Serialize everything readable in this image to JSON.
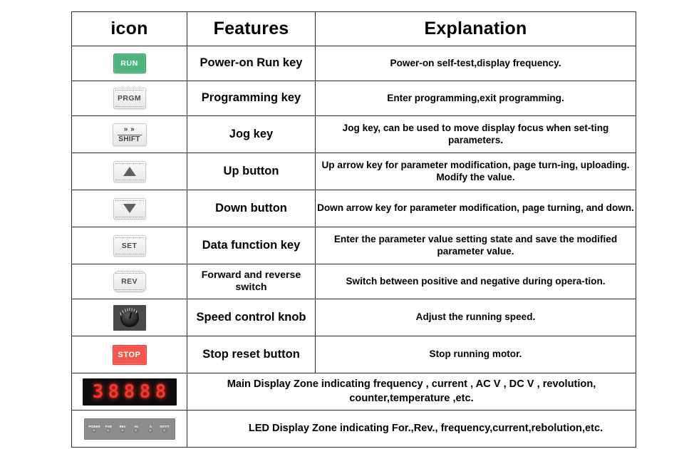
{
  "table": {
    "headers": {
      "icon": "icon",
      "features": "Features",
      "explanation": "Explanation"
    },
    "rows": [
      {
        "icon_kind": "run-key",
        "icon_label": "RUN",
        "feature": "Power-on  Run key",
        "explanation": "Power-on self-test,display frequency."
      },
      {
        "icon_kind": "prgm-key",
        "icon_label": "PRGM",
        "feature": "Programming  key",
        "explanation": "Enter programming,exit programming."
      },
      {
        "icon_kind": "shift-key",
        "icon_label_top": "» »",
        "icon_label": "SHIFT",
        "feature": "Jog  key",
        "explanation": "Jog key, can be used to move display focus when set-ting parameters."
      },
      {
        "icon_kind": "up-arrow-key",
        "icon_label": "",
        "feature": "Up  button",
        "explanation": "Up arrow key for parameter modification, page turn-ing, uploading. Modify the value."
      },
      {
        "icon_kind": "down-arrow-key",
        "icon_label": "",
        "feature": "Down  button",
        "explanation": "Down arrow key for parameter modification, page turning, and down."
      },
      {
        "icon_kind": "set-key",
        "icon_label": "SET",
        "feature": "Data function key",
        "explanation": "Enter the parameter value setting state and save the modified parameter value."
      },
      {
        "icon_kind": "rev-key",
        "icon_label": "REV",
        "feature": "Forward and reverse switch",
        "explanation": "Switch between positive and negative during opera-tion."
      },
      {
        "icon_kind": "speed-knob",
        "icon_label": "",
        "feature": "Speed control knob",
        "explanation": "Adjust the running speed."
      },
      {
        "icon_kind": "stop-key",
        "icon_label": "STOP",
        "feature": "Stop reset button",
        "explanation": "Stop running motor."
      }
    ],
    "merged_rows": [
      {
        "icon_kind": "seven-segment-display",
        "digits": [
          "3",
          "8",
          "8",
          "8",
          "8"
        ],
        "text": "Main  Display  Zone indicating frequency , current , AC V , DC V , revolution, counter,temperature ,etc."
      },
      {
        "icon_kind": "led-indicator-strip",
        "led_labels": [
          "POWER",
          "FOR",
          "REV",
          "Hz",
          "A",
          "ROT/T"
        ],
        "text": "LED  Display Zone indicating For.,Rev., frequency,current,rebolution,etc."
      }
    ]
  },
  "colors": {
    "run_green": "#4cb47c",
    "stop_red": "#f2574b",
    "segment_red": "#f4362b",
    "key_grey": "#f0f0f0",
    "border": "#2b2b2b",
    "led_plate": "#8c8c8c"
  }
}
